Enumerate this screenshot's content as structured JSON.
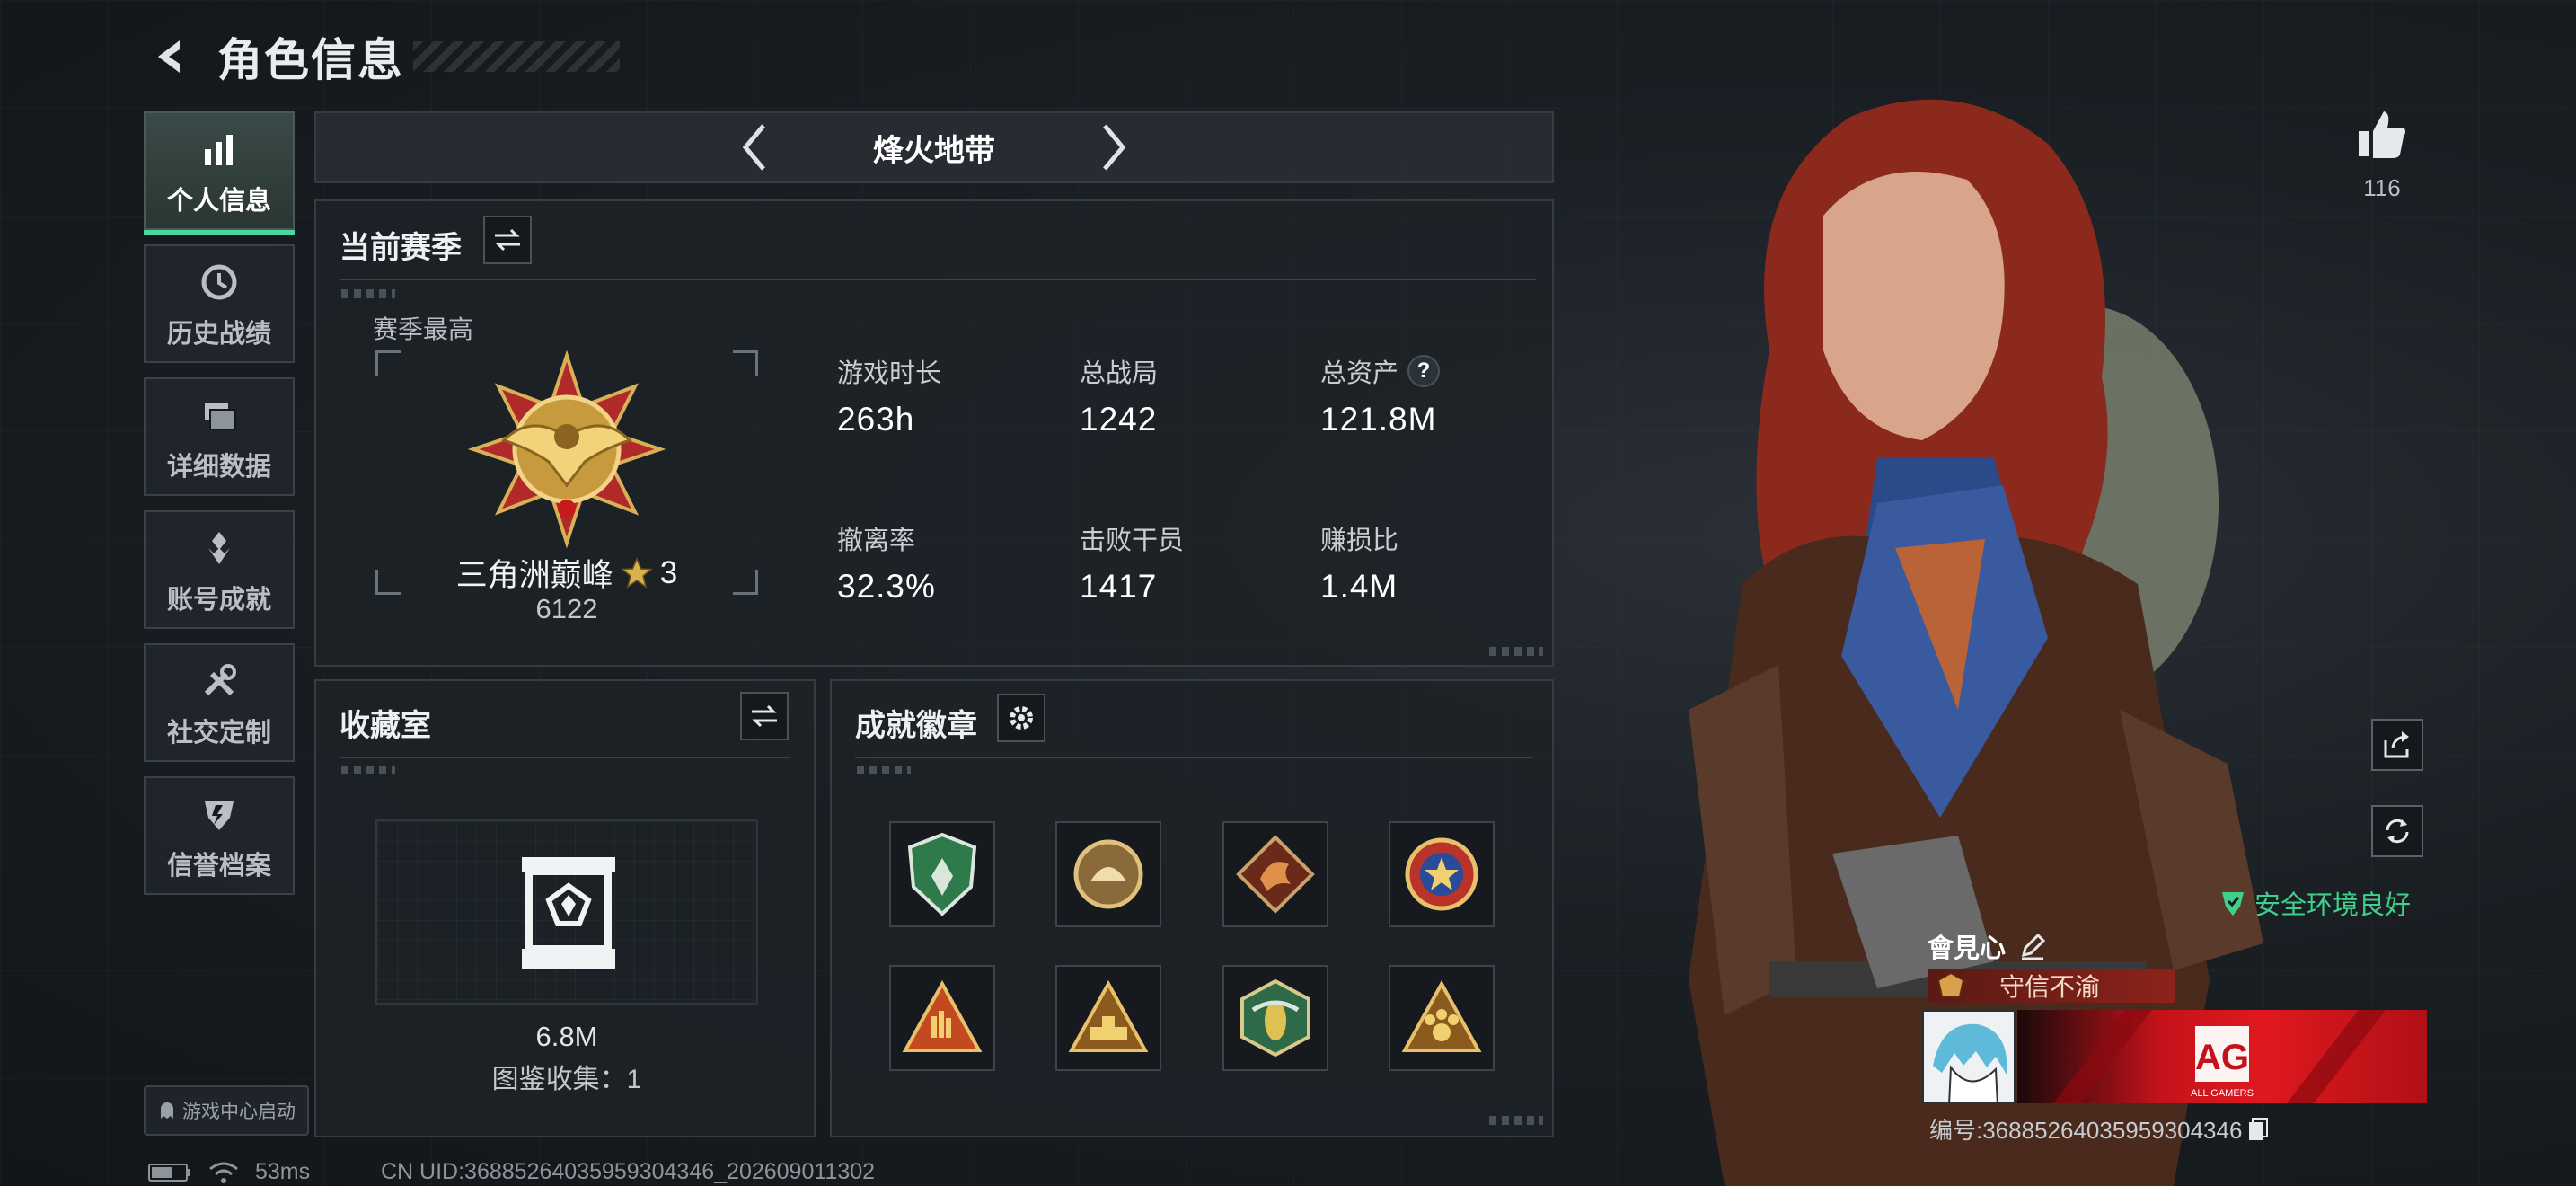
{
  "header": {
    "title": "角色信息"
  },
  "nav": {
    "items": [
      {
        "label": "个人信息",
        "icon": "bar-chart-icon",
        "active": true
      },
      {
        "label": "历史战绩",
        "icon": "clock-icon",
        "active": false
      },
      {
        "label": "详细数据",
        "icon": "folder-icon",
        "active": false
      },
      {
        "label": "账号成就",
        "icon": "achievement-icon",
        "active": false
      },
      {
        "label": "社交定制",
        "icon": "tools-icon",
        "active": false
      },
      {
        "label": "信誉档案",
        "icon": "shield-icon",
        "active": false
      }
    ],
    "game_center": "游戏中心启动"
  },
  "mode": {
    "title": "烽火地带"
  },
  "season": {
    "title": "当前赛季",
    "best_label": "赛季最高",
    "rank_name": "三角洲巅峰",
    "rank_stars": "3",
    "rank_points": "6122",
    "stats": [
      {
        "label": "游戏时长",
        "value": "263h"
      },
      {
        "label": "总战局",
        "value": "1242"
      },
      {
        "label": "总资产",
        "value": "121.8M",
        "help": "?"
      },
      {
        "label": "撤离率",
        "value": "32.3%"
      },
      {
        "label": "击败干员",
        "value": "1417"
      },
      {
        "label": "赚损比",
        "value": "1.4M"
      }
    ]
  },
  "collection": {
    "title": "收藏室",
    "value": "6.8M",
    "count_text": "图鉴收集：1"
  },
  "achievements": {
    "title": "成就徽章",
    "badges": [
      {
        "icon": "green-shield-badge-icon",
        "color": "#2f7a4a"
      },
      {
        "icon": "gold-shell-badge-icon",
        "color": "#b08a4a"
      },
      {
        "icon": "dragon-badge-icon",
        "color": "#a0482a"
      },
      {
        "icon": "blue-star-badge-icon",
        "color": "#b8342a"
      },
      {
        "icon": "rock-hand-badge-icon",
        "color": "#c24a1e"
      },
      {
        "icon": "tank-badge-icon",
        "color": "#c8901e"
      },
      {
        "icon": "wasp-badge-icon",
        "color": "#2e6a48"
      },
      {
        "icon": "paw-badge-icon",
        "color": "#c8901e"
      }
    ]
  },
  "profile": {
    "likes": "116",
    "safe_env": "安全环境良好",
    "name": "會見心",
    "honor": "守信不渝",
    "banner_text": "AG",
    "banner_subtext": "ALL GAMERS",
    "player_id": "编号:36885264035959304346"
  },
  "status": {
    "ping": "53ms",
    "uid": "CN UID:36885264035959304346_202609011302"
  },
  "colors": {
    "accent": "#4fd6a0",
    "safe": "#3fd08c",
    "honor": "#8c231b",
    "banner": "#e0181f"
  }
}
